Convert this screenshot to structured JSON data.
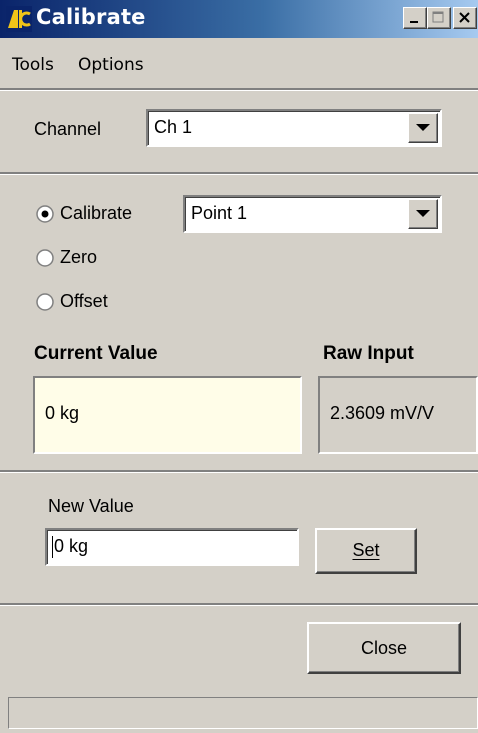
{
  "window": {
    "title": "Calibrate",
    "accent": "#0a246a"
  },
  "menu": [
    {
      "label": "Tools"
    },
    {
      "label": "Options"
    }
  ],
  "channel": {
    "label": "Channel",
    "selected": "Ch 1"
  },
  "mode": {
    "options": [
      {
        "label": "Calibrate",
        "checked": true
      },
      {
        "label": "Zero",
        "checked": false
      },
      {
        "label": "Offset",
        "checked": false
      }
    ],
    "point_selected": "Point 1"
  },
  "readings": {
    "current_label": "Current Value",
    "current_value": "0 kg",
    "raw_label": "Raw Input",
    "raw_value": "2.3609 mV/V",
    "current_bg": "#fffde8"
  },
  "new_value": {
    "label": "New Value",
    "value": "0 kg",
    "set_label": "Set"
  },
  "footer": {
    "close_label": "Close"
  }
}
